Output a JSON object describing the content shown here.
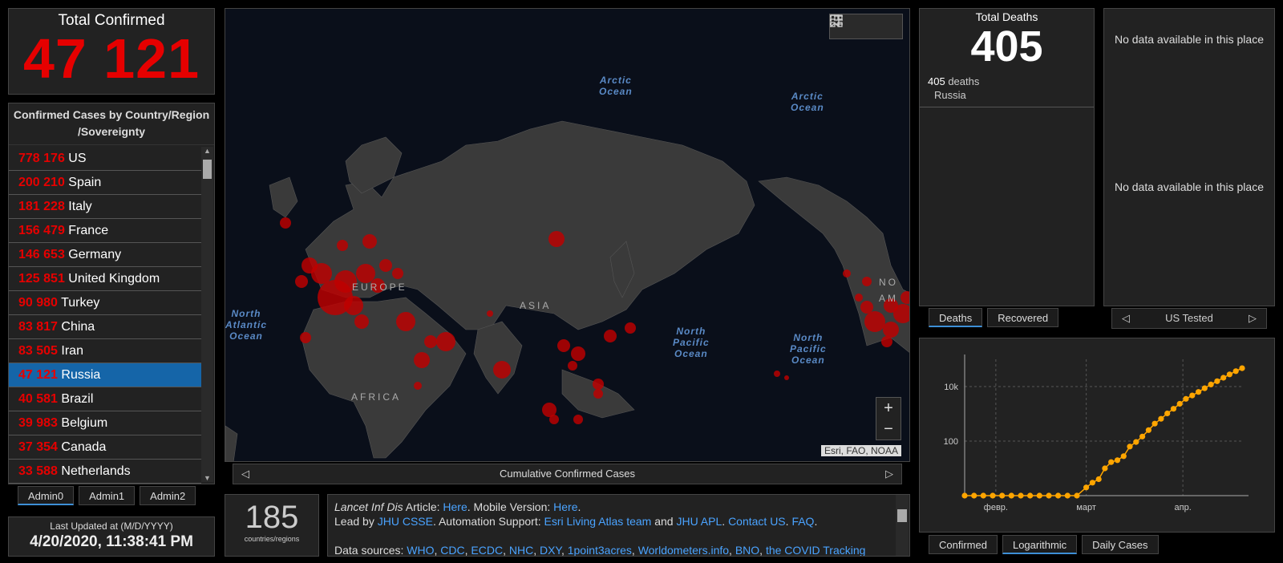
{
  "total_confirmed": {
    "label": "Total Confirmed",
    "value": "47 121"
  },
  "country_list": {
    "header_line1": "Confirmed Cases by Country/Region",
    "header_line2": "/Sovereignty",
    "rows": [
      {
        "count": "778 176",
        "name": "US"
      },
      {
        "count": "200 210",
        "name": "Spain"
      },
      {
        "count": "181 228",
        "name": "Italy"
      },
      {
        "count": "156 479",
        "name": "France"
      },
      {
        "count": "146 653",
        "name": "Germany"
      },
      {
        "count": "125 851",
        "name": "United Kingdom"
      },
      {
        "count": "90 980",
        "name": "Turkey"
      },
      {
        "count": "83 817",
        "name": "China"
      },
      {
        "count": "83 505",
        "name": "Iran"
      },
      {
        "count": "47 121",
        "name": "Russia"
      },
      {
        "count": "40 581",
        "name": "Brazil"
      },
      {
        "count": "39 983",
        "name": "Belgium"
      },
      {
        "count": "37 354",
        "name": "Canada"
      },
      {
        "count": "33 588",
        "name": "Netherlands"
      }
    ],
    "selected": "Russia"
  },
  "admin_tabs": [
    "Admin0",
    "Admin1",
    "Admin2"
  ],
  "last_updated": {
    "label": "Last Updated at (M/D/YYYY)",
    "value": "4/20/2020, 11:38:41 PM"
  },
  "map": {
    "oceans": {
      "arctic_1": [
        "Arctic",
        "Ocean"
      ],
      "arctic_2": [
        "Arctic",
        "Ocean"
      ],
      "north_atlantic": [
        "North",
        "Atlantic",
        "Ocean"
      ],
      "north_pacific_1": [
        "North",
        "Pacific",
        "Ocean"
      ],
      "north_pacific_2": [
        "North",
        "Pacific",
        "Ocean"
      ]
    },
    "regions": {
      "europe": "EUROPE",
      "asia": "ASIA",
      "africa": "AFRICA",
      "north_america_1": "NO",
      "north_america_2": "AM"
    },
    "attribution": "Esri, FAO, NOAA",
    "caption": "Cumulative Confirmed Cases",
    "zoom_in": "+",
    "zoom_out": "−"
  },
  "country_count": {
    "value": "185",
    "label": "countries/regions"
  },
  "info": {
    "line1_prefix": "Lancet Inf Dis",
    "line1_mid": " Article: ",
    "line1_link1": "Here",
    "line1_mid2": ". Mobile Version: ",
    "line1_link2": "Here",
    "line1_end": ".",
    "line2_prefix": "Lead by ",
    "line2_link1": "JHU CSSE",
    "line2_mid": ". Automation Support: ",
    "line2_link2": "Esri Living Atlas team",
    "line2_and": " and ",
    "line2_link3": "JHU APL",
    "line2_sep": ". ",
    "line2_link4": "Contact US",
    "line2_sep2": ". ",
    "line2_link5": "FAQ",
    "line2_end": ".",
    "line4_prefix": "Data sources: ",
    "sources": [
      "WHO",
      "CDC",
      "ECDC",
      "NHC",
      "DXY",
      "1point3acres",
      "Worldometers.info",
      "BNO",
      "the COVID Tracking"
    ]
  },
  "deaths": {
    "label": "Total Deaths",
    "value": "405",
    "detail_count": "405",
    "detail_unit": " deaths",
    "detail_country": "Russia"
  },
  "deaths_tabs": [
    "Deaths",
    "Recovered"
  ],
  "tested": {
    "message_top": "No data available in this place",
    "message_mid": "No data available in this place",
    "nav_label": "US Tested",
    "prev": "◁",
    "next": "▷"
  },
  "chart_tabs": [
    "Confirmed",
    "Logarithmic",
    "Daily Cases"
  ],
  "chart_data": {
    "type": "line",
    "scale": "log",
    "xlabel": "",
    "ylabel": "",
    "x_ticks": [
      "февр.",
      "март",
      "апр."
    ],
    "y_ticks": [
      "100",
      "10k"
    ],
    "color": "#ffa500",
    "series": [
      {
        "x": [
          "2020-01-22",
          "2020-01-25",
          "2020-01-28",
          "2020-01-31",
          "2020-02-03",
          "2020-02-06",
          "2020-02-09",
          "2020-02-12",
          "2020-02-15",
          "2020-02-18",
          "2020-02-21",
          "2020-02-24",
          "2020-02-27",
          "2020-03-01",
          "2020-03-03",
          "2020-03-05",
          "2020-03-07",
          "2020-03-09",
          "2020-03-11",
          "2020-03-13",
          "2020-03-15",
          "2020-03-17",
          "2020-03-19",
          "2020-03-21",
          "2020-03-23",
          "2020-03-25",
          "2020-03-27",
          "2020-03-29",
          "2020-03-31",
          "2020-04-02",
          "2020-04-04",
          "2020-04-06",
          "2020-04-08",
          "2020-04-10",
          "2020-04-12",
          "2020-04-14",
          "2020-04-16",
          "2020-04-18",
          "2020-04-20"
        ],
        "values": [
          0,
          0,
          0,
          0,
          0,
          0,
          0,
          0,
          0,
          0,
          0,
          0,
          0,
          2,
          3,
          4,
          10,
          17,
          20,
          28,
          63,
          93,
          147,
          253,
          438,
          658,
          1036,
          1534,
          2337,
          3548,
          4731,
          6343,
          8672,
          11917,
          15770,
          21102,
          27938,
          36793,
          47121
        ]
      }
    ]
  }
}
